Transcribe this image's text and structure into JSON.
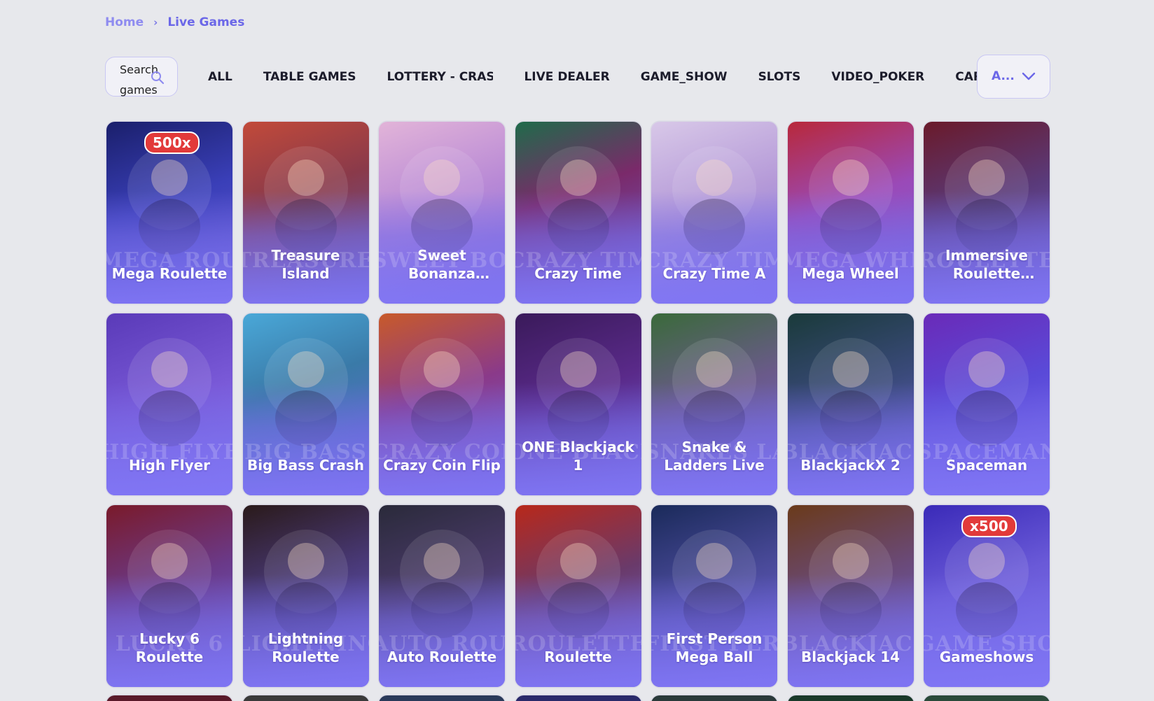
{
  "breadcrumb": {
    "home": "Home",
    "current": "Live Games"
  },
  "search": {
    "placeholder": "Search games"
  },
  "tabs": [
    "ALL",
    "TABLE GAMES",
    "LOTTERY - CRASH",
    "LIVE DEALER",
    "GAME_SHOW",
    "SLOTS",
    "VIDEO_POKER",
    "CARD"
  ],
  "sort": {
    "label": "A..."
  },
  "colors": {
    "accent": "#6b67e8",
    "page_background": "#e7e8ec",
    "card_overlay": "#8076f5"
  },
  "games": [
    {
      "title": "Mega Roulette",
      "watermark": "MEGA ROULETTE",
      "badge": "500x",
      "art": "linear-gradient(160deg,#1a1f6b 0%,#3a3fb8 45%,#6b5fd8 100%)"
    },
    {
      "title": "Treasure Island",
      "watermark": "TREASURE ISLAND",
      "art": "linear-gradient(160deg,#c24a3a 0%,#8a3a4a 40%,#5a5ab8 100%)"
    },
    {
      "title": "Sweet Bonanza Candyland",
      "watermark": "SWEET BONANZA",
      "art": "linear-gradient(160deg,#e2b4d8 0%,#b889d6 45%,#7c6be0 100%)"
    },
    {
      "title": "Crazy Time",
      "watermark": "CRAZY TIME",
      "art": "linear-gradient(160deg,#1f6b4a 0%,#7a2a6a 40%,#6a5fd8 100%)"
    },
    {
      "title": "Crazy Time A",
      "watermark": "CRAZY TIME",
      "art": "linear-gradient(160deg,#d8c8e8 0%,#b59ad8 45%,#7d70e0 100%)"
    },
    {
      "title": "Mega Wheel",
      "watermark": "MEGA WHEEL",
      "art": "linear-gradient(160deg,#b8283a 0%,#9a4ab8 45%,#7468e0 100%)"
    },
    {
      "title": "Immersive Roulette Deluxe",
      "watermark": "ROULETTE",
      "art": "linear-gradient(160deg,#6a1a2a 0%,#5a3a7a 45%,#7066d8 100%)"
    },
    {
      "title": "High Flyer",
      "watermark": "HIGH FLYER",
      "art": "linear-gradient(160deg,#5a3ab8 0%,#7a5ad8 50%,#8576f0 100%)"
    },
    {
      "title": "Big Bass Crash",
      "watermark": "BIG BASS",
      "art": "linear-gradient(160deg,#4aa8d8 0%,#3a7aa8 40%,#6a62d8 100%)"
    },
    {
      "title": "Crazy Coin Flip",
      "watermark": "CRAZY COIN",
      "art": "linear-gradient(160deg,#c85a2a 0%,#8a3a8a 45%,#6f64dc 100%)"
    },
    {
      "title": "ONE Blackjack 1",
      "watermark": "ONE BLACKJACK",
      "art": "linear-gradient(160deg,#3a1a5a 0%,#5a2a8a 45%,#7066dc 100%)"
    },
    {
      "title": "Snake & Ladders Live",
      "watermark": "SNAKES LADDERS",
      "art": "linear-gradient(160deg,#3a6a3a 0%,#6a5a8a 45%,#7468e0 100%)"
    },
    {
      "title": "BlackjackX 2",
      "watermark": "BLACKJACK",
      "art": "linear-gradient(160deg,#1a3a3a 0%,#3a4a7a 45%,#6f66dc 100%)"
    },
    {
      "title": "Spaceman",
      "watermark": "SPACEMAN",
      "art": "linear-gradient(160deg,#6a2ab8 0%,#5a4ad8 45%,#7a6cf0 100%)"
    },
    {
      "title": "Lucky 6 Roulette",
      "watermark": "LUCKY 6",
      "art": "linear-gradient(160deg,#7a1a2a 0%,#6a3a8a 45%,#7066dc 100%)"
    },
    {
      "title": "Lightning Roulette",
      "watermark": "LIGHTNING",
      "art": "linear-gradient(160deg,#2a1a1a 0%,#4a3a7a 45%,#6f66dc 100%)"
    },
    {
      "title": "Auto Roulette",
      "watermark": "AUTO ROULETTE",
      "art": "linear-gradient(160deg,#2a2a3a 0%,#4a3a6a 45%,#6f66dc 100%)"
    },
    {
      "title": "Roulette",
      "watermark": "ROULETTE",
      "art": "linear-gradient(160deg,#b8281a 0%,#6a3a6a 45%,#6f66dc 100%)"
    },
    {
      "title": "First Person Mega Ball",
      "watermark": "FIRST PERSON",
      "art": "linear-gradient(160deg,#1a2a5a 0%,#4a4a9a 45%,#7468e0 100%)"
    },
    {
      "title": "Blackjack 14",
      "watermark": "BLACKJACK",
      "art": "linear-gradient(160deg,#6a3a1a 0%,#6a4a7a 45%,#7066dc 100%)"
    },
    {
      "title": "Gameshows",
      "watermark": "GAME SHOWS",
      "badge": "x500",
      "art": "linear-gradient(160deg,#3a2ab8 0%,#6a5ad8 45%,#8076f0 100%)"
    }
  ],
  "peek_cards": [
    {
      "art": "#5a1a2a"
    },
    {
      "art": "#3a3a3a"
    },
    {
      "art": "#2a3a5a"
    },
    {
      "art": "#2a2a6a"
    },
    {
      "art": "#2a3a3a"
    },
    {
      "art": "#1a3a2a"
    },
    {
      "art": "#2a4a3a"
    }
  ]
}
